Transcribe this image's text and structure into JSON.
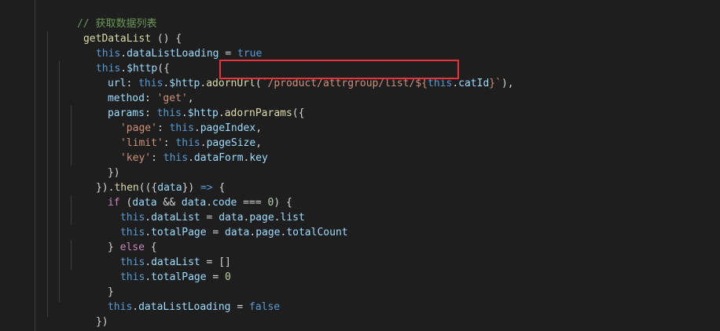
{
  "colors": {
    "background": "#1e1e1e",
    "keyword": "#569cd6",
    "property": "#9cdcfe",
    "function": "#dcdcaa",
    "string": "#ce9178",
    "number": "#b5cea8",
    "comment": "#6a9955",
    "control": "#c586c0",
    "highlight_box": "#e8333a"
  },
  "code": {
    "comment": "// 获取数据列表",
    "fn_name": "getDataList",
    "fn_sig_rest": " () {",
    "this": "this",
    "dot": ".",
    "dataListLoading": "dataListLoading",
    "assign": " = ",
    "true": "true",
    "false": "false",
    "http": "$http",
    "open_call": "({",
    "url_key": "url",
    "colon": ": ",
    "adornUrl": "adornUrl",
    "open_paren": "(",
    "template_start": "`/product/attrgroup/list/${",
    "catId": "catId",
    "template_end": "}`",
    "close_paren_comma": "),",
    "method_key": "method",
    "method_value": "'get'",
    "comma": ",",
    "params_key": "params",
    "adornParams": "adornParams",
    "open_brace_paren": "({",
    "page_key": "'page'",
    "pageIndex": "pageIndex",
    "limit_key": "'limit'",
    "pageSize": "pageSize",
    "key_key": "'key'",
    "dataForm": "dataForm",
    "key_prop": "key",
    "close_params": "})",
    "then_close": "}).",
    "then": "then",
    "then_open": "(({",
    "data": "data",
    "then_arrow_close": "}) ",
    "arrow": "=>",
    "brace_open": " {",
    "if": "if",
    "if_open": " (",
    "and": " && ",
    "code_prop": "code",
    "eq3": " === ",
    "zero": "0",
    "if_close": ") {",
    "dataList": "dataList",
    "page": "page",
    "list": "list",
    "totalPage": "totalPage",
    "totalCount": "totalCount",
    "else_close": "} ",
    "else": "else",
    "empty_array": "[]",
    "close_brace": "}",
    "close_call": "})",
    "close_method": "},"
  }
}
